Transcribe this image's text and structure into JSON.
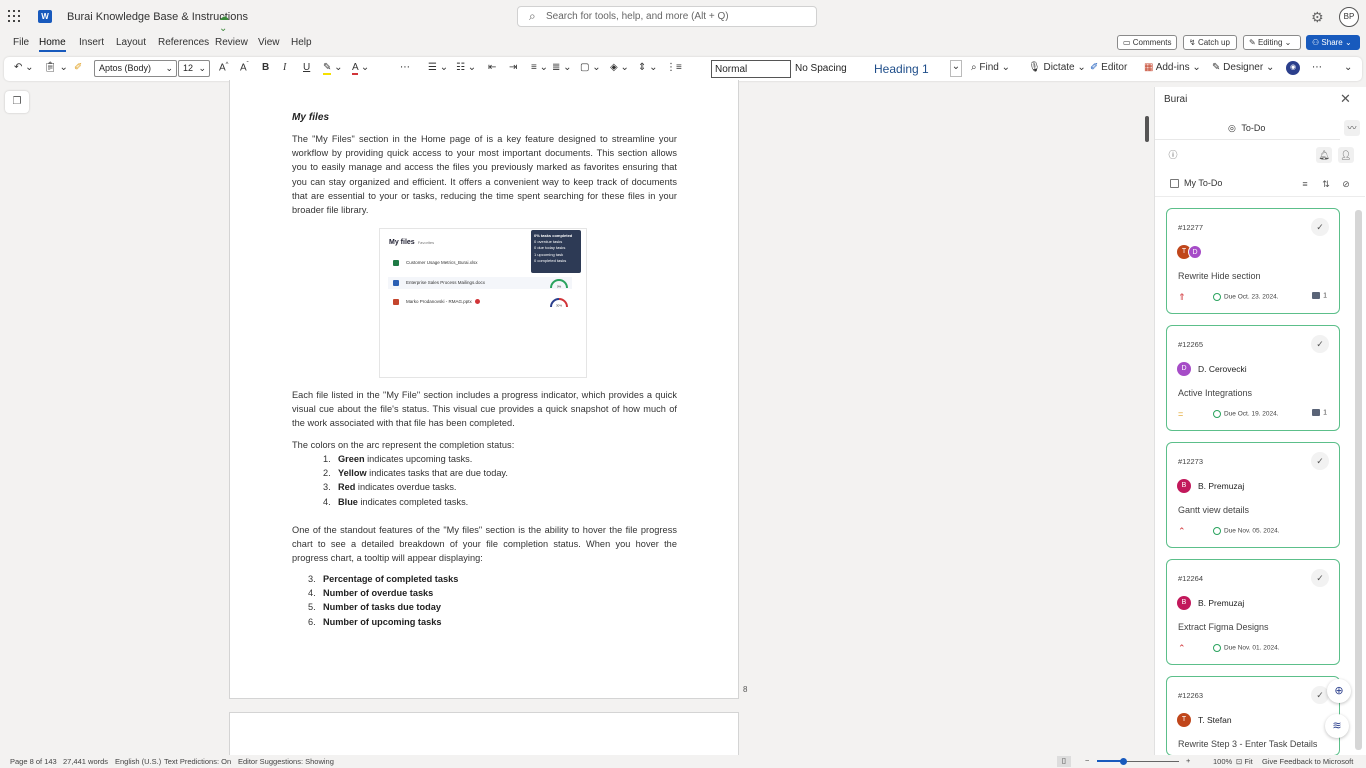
{
  "titlebar": {
    "doc_title": "Burai Knowledge Base & Instructions",
    "search_placeholder": "Search for tools, help, and more (Alt + Q)",
    "avatar_initials": "BP"
  },
  "menu": [
    "File",
    "Home",
    "Insert",
    "Layout",
    "References",
    "Review",
    "View",
    "Help"
  ],
  "menu_active": "Home",
  "actions": {
    "comments": "Comments",
    "catchup": "Catch up",
    "editing": "Editing",
    "share": "Share"
  },
  "ribbon": {
    "font_name": "Aptos (Body)",
    "font_size": "12",
    "styles": [
      "Normal",
      "No Spacing",
      "Heading 1"
    ],
    "find": "Find",
    "dictate": "Dictate",
    "editor": "Editor",
    "addins": "Add-ins",
    "designer": "Designer"
  },
  "document": {
    "heading": "My files",
    "p1": "The \"My Files\" section in the Home page of is a key feature designed to streamline your workflow by providing quick access to your most important documents. This section allows you to easily manage and access the files you previously marked as favorites ensuring that you can stay organized and efficient. It offers a convenient way to keep track of documents that are essential to your or tasks, reducing the time spent searching for these files in your broader file library.",
    "p2": "Each file listed in the \"My File\" section includes a progress indicator, which provides a quick visual cue about the file's status. This visual cue provides a quick snapshot of how much of the work associated with that file has been completed.",
    "p3": "The colors on the arc represent the completion status:",
    "color_list": [
      {
        "num": "1.",
        "bold": "Green",
        "rest": " indicates upcoming tasks."
      },
      {
        "num": "2.",
        "bold": "Yellow",
        "rest": " indicates tasks that are due today."
      },
      {
        "num": "3.",
        "bold": "Red",
        "rest": " indicates overdue tasks."
      },
      {
        "num": "4.",
        "bold": "Blue",
        "rest": " indicates completed tasks."
      }
    ],
    "p4": "One of the standout features of the \"My files\" section is the ability to hover the file progress chart to see a detailed breakdown of your file completion status. When you hover the progress chart, a tooltip will appear displaying:",
    "tooltip_list": [
      {
        "num": "3.",
        "text": "Percentage of completed tasks"
      },
      {
        "num": "4.",
        "text": "Number of overdue tasks"
      },
      {
        "num": "5.",
        "text": "Number of tasks due today"
      },
      {
        "num": "6.",
        "text": "Number of upcoming tasks"
      }
    ],
    "page_number": "8",
    "embedded": {
      "title": "My files",
      "subtitle": "Favorites",
      "files": [
        {
          "name": "Customer Usage Metrics_Burai.xlsx",
          "color": "#1f7a45"
        },
        {
          "name": "Enterprise Sales Process Mailings.docx",
          "color": "#2b5fb3",
          "arc": "0%"
        },
        {
          "name": "Marko Prodanovski - RMAG.pptx",
          "color": "#c4452d",
          "arc": "30%"
        }
      ],
      "tooltip": [
        "0% tasks completed",
        "0 overdue tasks",
        "0 due today tasks",
        "1 upcoming task",
        "0 completed tasks"
      ]
    }
  },
  "panel": {
    "title": "Burai",
    "tab": "To-Do",
    "filter_label": "My To-Do",
    "cards": [
      {
        "num": "#12277",
        "avatars": [
          "T",
          "D"
        ],
        "name": "",
        "title": "Rewrite Hide section",
        "prio": "high",
        "due": "Due Oct. 23. 2024.",
        "comments": "1"
      },
      {
        "num": "#12265",
        "avatars": [
          "D"
        ],
        "name": "D. Cerovecki",
        "title": "Active Integrations",
        "prio": "medium",
        "due": "Due Oct. 19. 2024.",
        "comments": "1"
      },
      {
        "num": "#12273",
        "avatars": [
          "B"
        ],
        "name": "B. Premuzaj",
        "title": "Gantt view details",
        "prio": "low",
        "due": "Due Nov. 05. 2024.",
        "comments": ""
      },
      {
        "num": "#12264",
        "avatars": [
          "B"
        ],
        "name": "B. Premuzaj",
        "title": "Extract Figma Designs",
        "prio": "low",
        "due": "Due Nov. 01. 2024.",
        "comments": ""
      },
      {
        "num": "#12263",
        "avatars": [
          "T"
        ],
        "name": "T. Stefan",
        "title": "Rewrite Step 3 - Enter Task Details",
        "prio": "",
        "due": "",
        "comments": ""
      }
    ]
  },
  "status": {
    "page": "Page 8 of 143",
    "words": "27,441 words",
    "lang": "English (U.S.)",
    "predictions": "Text Predictions: On",
    "editor": "Editor Suggestions: Showing",
    "zoom": "100%",
    "fit": "Fit",
    "feedback": "Give Feedback to Microsoft"
  },
  "colors": {
    "accent": "#185abd",
    "card_border": "#5cbf8a"
  }
}
